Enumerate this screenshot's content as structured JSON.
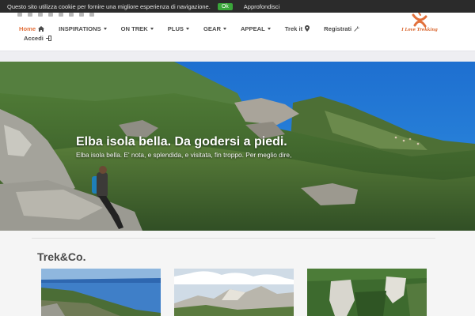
{
  "cookie": {
    "message": "Questo sito utilizza cookie per fornire una migliore esperienza di navigazione.",
    "ok_label": "Ok",
    "more_label": "Approfondisci"
  },
  "header": {
    "social_icons": [
      "linkedin-icon",
      "email-icon",
      "twitter-icon",
      "facebook-icon",
      "google-plus-icon",
      "instagram-icon",
      "youtube-icon",
      "linkedin-icon"
    ],
    "logo_text": "I Love Trekking"
  },
  "nav": {
    "items": [
      {
        "label": "Home",
        "icon": "home-icon",
        "active": true
      },
      {
        "label": "INSPIRATIONS",
        "icon": "caret-down-icon"
      },
      {
        "label": "ON TREK",
        "icon": "caret-down-icon"
      },
      {
        "label": "PLUS",
        "icon": "caret-down-icon"
      },
      {
        "label": "GEAR",
        "icon": "caret-down-icon"
      },
      {
        "label": "APPEAL",
        "icon": "caret-down-icon"
      },
      {
        "label": "Trek it",
        "icon": "map-marker-icon"
      },
      {
        "label": "Registrati",
        "icon": "wrench-icon"
      }
    ],
    "login_label": "Accedi",
    "login_icon": "sign-in-icon"
  },
  "hero": {
    "title": "Elba isola bella. Da godersi a piedi.",
    "subtitle": "Elba isola bella. E' nota, e splendida, e visitata, fin troppo. Per meglio dire,"
  },
  "section": {
    "title": "Trek&Co."
  },
  "colors": {
    "accent": "#e2703b",
    "ok_green": "#3aa63a",
    "cookie_bg": "#2b2b2b"
  }
}
